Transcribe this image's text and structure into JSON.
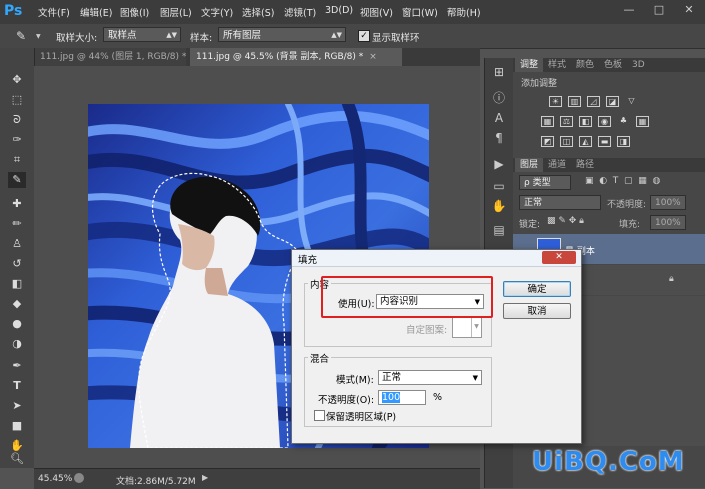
{
  "app": {
    "logo": "Ps"
  },
  "menu": [
    "文件(F)",
    "编辑(E)",
    "图像(I)",
    "图层(L)",
    "文字(Y)",
    "选择(S)",
    "滤镜(T)",
    "3D(D)",
    "视图(V)",
    "窗口(W)",
    "帮助(H)"
  ],
  "window_controls": [
    "—",
    "□",
    "✕"
  ],
  "options": {
    "sample_size_label": "取样大小:",
    "sample_size_value": "取样点",
    "sample_label": "样本:",
    "sample_value": "所有图层",
    "show_ring_label": "显示取样环"
  },
  "tabs": [
    {
      "label": "111.jpg @ 44% (图层 1, RGB/8) *",
      "close": "×"
    },
    {
      "label": "111.jpg @ 45.5% (背景 副本, RGB/8) *",
      "close": "×"
    }
  ],
  "status": {
    "zoom": "45.45%",
    "doc": "文档:2.86M/5.72M"
  },
  "panels": {
    "adjust_tabs": [
      "调整",
      "样式",
      "颜色",
      "色板",
      "3D"
    ],
    "adjust_hint": "添加调整",
    "layer_tabs": [
      "图层",
      "通道",
      "路径"
    ],
    "kind_label": "ρ 类型",
    "blend_mode": "正常",
    "opacity_label": "不透明度:",
    "opacity_value": "100%",
    "lock_label": "锁定:",
    "fill_label": "填充:",
    "fill_value": "100%",
    "layer_name": "景 副本"
  },
  "watermark": "UiBQ.CoM",
  "dialog": {
    "title": "填充",
    "close": "✕",
    "contents_group": "内容",
    "use_label": "使用(U):",
    "use_value": "内容识别",
    "custom_pattern_label": "自定图案:",
    "blend_group": "混合",
    "mode_label": "模式(M):",
    "mode_value": "正常",
    "opacity_label": "不透明度(O):",
    "opacity_value": "100",
    "percent": "%",
    "preserve_label": "保留透明区域(P)",
    "ok_label": "确定",
    "cancel_label": "取消"
  },
  "colors": {
    "highlight_box": "#e02020",
    "accent": "#31a8ff",
    "watermark": "#2e8cf0"
  }
}
